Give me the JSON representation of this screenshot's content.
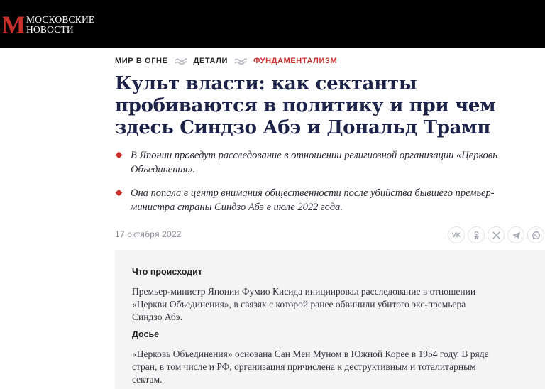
{
  "header": {
    "logo_line1": "МОСКОВСКИЕ",
    "logo_line2": "НОВОСТИ",
    "logo_glyph": "M"
  },
  "rubrics": [
    {
      "label": "МИР В ОГНЕ",
      "accent": false
    },
    {
      "label": "ДЕТАЛИ",
      "accent": false
    },
    {
      "label": "ФУНДАМЕНТАЛИЗМ",
      "accent": true
    }
  ],
  "article": {
    "title_lines": [
      "Культ власти: как сектанты",
      "пробиваются в политику и при чем",
      "здесь Синдзо Абэ и Дональд Трамп"
    ],
    "leads": [
      [
        "В Японии проведут расследование в отношении религиозной организации «Церковь",
        "Объединения»."
      ],
      [
        "Она попала в центр внимания общественности после убийства бывшего премьер-",
        "министра страны Синдзо Абэ в июле 2022 года."
      ]
    ],
    "date": "17 октября 2022"
  },
  "share": {
    "vk": "VK",
    "ok_icon": "odnoklassniki-icon",
    "x_icon": "x-icon",
    "telegram_icon": "telegram-icon",
    "whatsapp_icon": "whatsapp-icon"
  },
  "infobox": {
    "section1_heading": "Что происходит",
    "section1_lines": [
      "Премьер-министр Японии Фумио Кисида инициировал расследование в отношении",
      "«Церкви Объединения», в связях с которой ранее обвинили убитого экс-премьера",
      "Синдзо Абэ."
    ],
    "section2_heading": "Досье",
    "section2_lines": [
      "«Церковь Объединения» основана Сан Мен Муном в Южной Корее в 1954 году. В ряде",
      "стран, в том числе и РФ, организация причислена к деструктивным и тоталитарным",
      "сектам."
    ]
  },
  "colors": {
    "accent": "#c9302c",
    "title": "#1d2348",
    "header_bg": "#000000",
    "infobox_bg": "#f4f4f5"
  }
}
